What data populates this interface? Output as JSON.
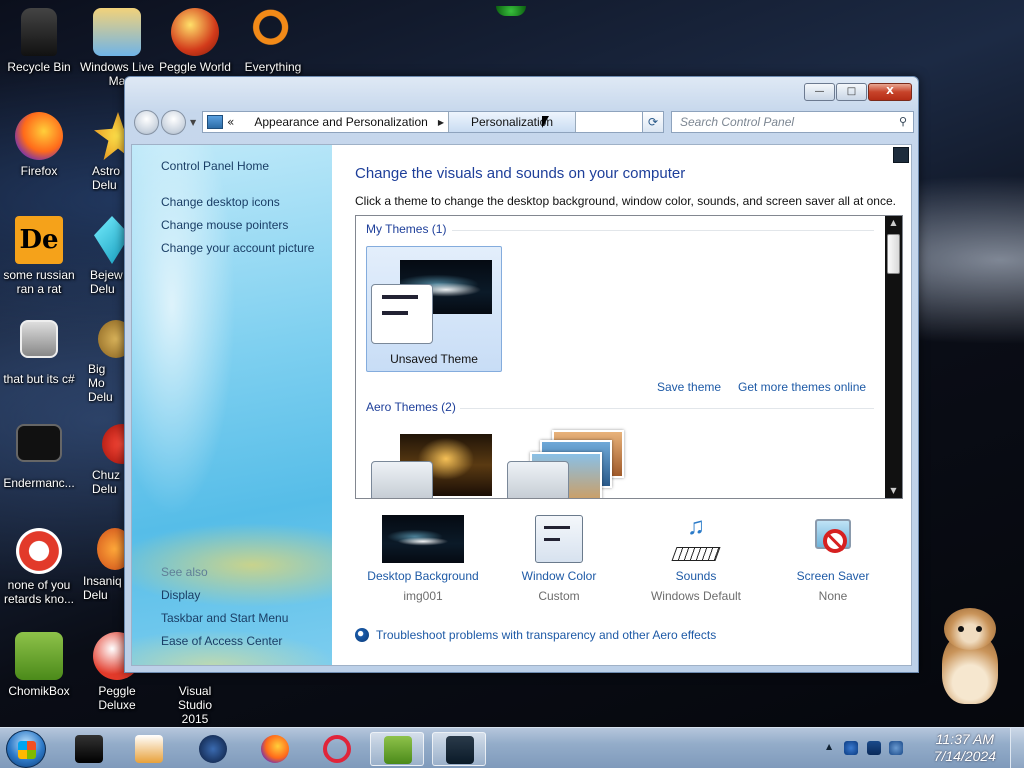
{
  "desktop": {
    "icons": [
      {
        "label": "Recycle Bin",
        "icon": "recycle-bin-icon"
      },
      {
        "label": "Windows Live Ma",
        "icon": "mail-icon"
      },
      {
        "label": "Peggle World",
        "icon": "peggle-icon"
      },
      {
        "label": "Everything",
        "icon": "everything-search-icon"
      },
      {
        "label": "Firefox",
        "icon": "firefox-icon"
      },
      {
        "label": "Astro Delu",
        "icon": "star-icon"
      },
      {
        "label": "some russian ran a rat",
        "icon": "de-icon"
      },
      {
        "label": "Bejew Delu",
        "icon": "gem-icon"
      },
      {
        "label": "that but its c#",
        "icon": "stacked-windows-icon"
      },
      {
        "label": "Big Mo Delu",
        "icon": "money-bag-icon"
      },
      {
        "label": "Endermanc...",
        "icon": "terminal-icon"
      },
      {
        "label": "Chuz Delu",
        "icon": "chuzzle-icon"
      },
      {
        "label": "none of you retards kno...",
        "icon": "rat-icon"
      },
      {
        "label": "Insaniq Delu",
        "icon": "insaniquarium-icon"
      },
      {
        "label": "ChomikBox",
        "icon": "chomikbox-icon"
      },
      {
        "label": "Peggle Deluxe",
        "icon": "peggle-deluxe-icon"
      },
      {
        "label": "Visual Studio 2015",
        "icon": "visual-studio-icon"
      }
    ]
  },
  "window": {
    "controls": {
      "minimize": "—",
      "maximize": "□",
      "close": "X"
    },
    "address": {
      "prefix": "«",
      "crumbs": [
        "Appearance and Personalization",
        "Personalization"
      ]
    },
    "search": {
      "placeholder": "Search Control Panel"
    },
    "left_pane": {
      "home": "Control Panel Home",
      "links": [
        "Change desktop icons",
        "Change mouse pointers",
        "Change your account picture"
      ],
      "see_also_heading": "See also",
      "see_also": [
        "Display",
        "Taskbar and Start Menu",
        "Ease of Access Center"
      ]
    },
    "main": {
      "title": "Change the visuals and sounds on your computer",
      "subtitle": "Click a theme to change the desktop background, window color, sounds, and screen saver all at once.",
      "my_themes_heading": "My Themes (1)",
      "my_themes": [
        {
          "name": "Unsaved Theme",
          "selected": true
        }
      ],
      "save_theme": "Save theme",
      "get_more": "Get more themes online",
      "aero_themes_heading": "Aero Themes (2)",
      "bottom": [
        {
          "label": "Desktop Background",
          "value": "img001",
          "icon": "desktop-background-icon"
        },
        {
          "label": "Window Color",
          "value": "Custom",
          "icon": "window-color-icon"
        },
        {
          "label": "Sounds",
          "value": "Windows Default",
          "icon": "sounds-icon"
        },
        {
          "label": "Screen Saver",
          "value": "None",
          "icon": "screen-saver-icon"
        }
      ],
      "troubleshoot": "Troubleshoot problems with transparency and other Aero effects"
    }
  },
  "taskbar": {
    "apps": [
      "explorer",
      "media-player",
      "app-sphere",
      "firefox",
      "opera",
      "chomikbox",
      "control-panel"
    ],
    "clock_time": "11:37 AM",
    "clock_date": "7/14/2024"
  },
  "colors": {
    "link": "#1e5aa6",
    "title": "#1e3f9a",
    "taskbar": "#93acc9"
  }
}
